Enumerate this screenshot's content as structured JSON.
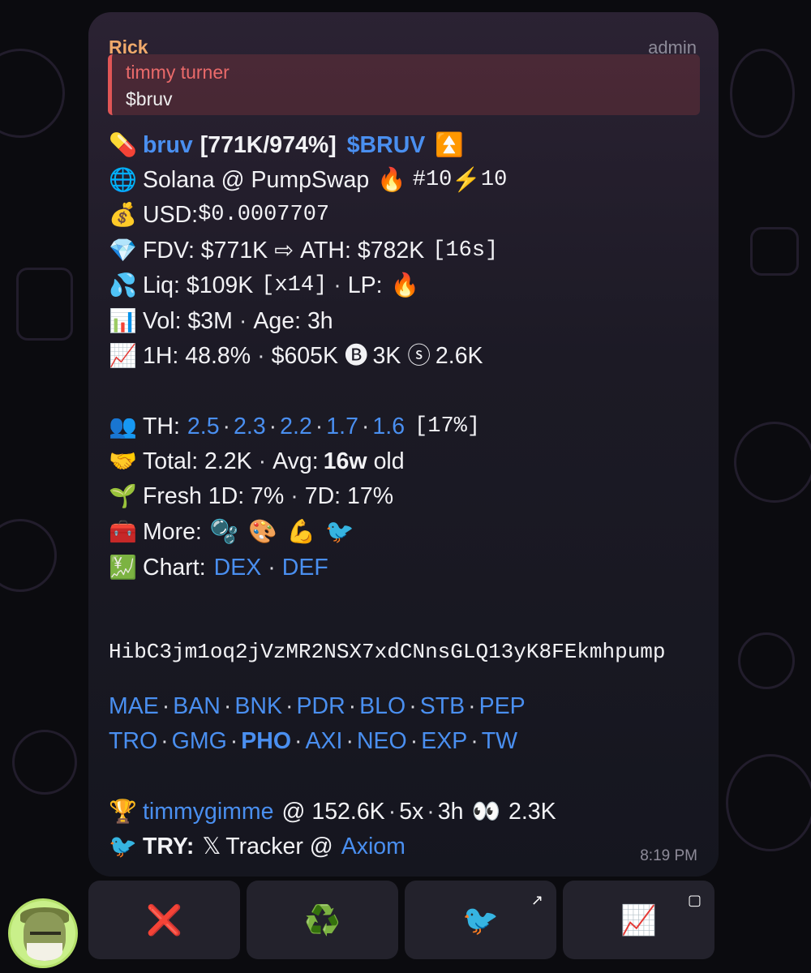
{
  "message": {
    "sender": "Rick",
    "role": "admin",
    "reply": {
      "name": "timmy turner",
      "text": "$bruv"
    },
    "time": "8:19 PM",
    "lines": {
      "title": {
        "icon": "💊",
        "name": "bruv",
        "stats": "[771K/974%]",
        "ticker": "$BRUV",
        "badge": "⏫"
      },
      "chain": {
        "icon": "🌐",
        "text": "Solana @ PumpSwap",
        "fire": "🔥",
        "rank": "#10",
        "bolt": "⚡",
        "boost": "10"
      },
      "usd": {
        "icon": "💰",
        "label": "USD: ",
        "value": "$0.0007707"
      },
      "fdv": {
        "icon": "💎",
        "label": "FDV: $771K",
        "arrow": "⇨",
        "ath": "ATH: $782K",
        "age": "[16s]"
      },
      "liq": {
        "icon": "💦",
        "label": "Liq: $109K",
        "mult": "[x14]",
        "sep": "·",
        "lp": "LP:",
        "lp_icon": "🔥"
      },
      "vol": {
        "icon": "📊",
        "vol": "Vol: $3M",
        "sep": "·",
        "age": "Age: 3h"
      },
      "h1": {
        "icon": "📈",
        "pct": "1H: 48.8%",
        "sep": "·",
        "vol": "$605K",
        "buy_icon": "🅑",
        "buys": "3K",
        "sell_icon": "ⓢ",
        "sells": "2.6K"
      },
      "th": {
        "icon": "👥",
        "label": "TH:",
        "values": [
          "2.5",
          "2.3",
          "2.2",
          "1.7",
          "1.6"
        ],
        "dot": "·",
        "pct": "[17%]"
      },
      "total": {
        "icon": "🤝",
        "label": "Total: 2.2K",
        "sep": "·",
        "avg": "Avg: ",
        "avg_value": "16w",
        "old": "old"
      },
      "fresh": {
        "icon": "🌱",
        "d1": "Fresh 1D: 7%",
        "sep": "·",
        "d7": "7D: 17%"
      },
      "more": {
        "icon": "🧰",
        "label": "More:",
        "items": [
          "🫧",
          "🎨",
          "💪",
          "🐦"
        ]
      },
      "chart": {
        "icon": "💹",
        "label": "Chart:",
        "dex": "DEX",
        "sep": "·",
        "def": "DEF"
      }
    },
    "contract": "HibC3jm1oq2jVzMR2NSX7xdCNnsGLQ13yK8FEkmhpump",
    "bot_links_row1": [
      "MAE",
      "BAN",
      "BNK",
      "PDR",
      "BLO",
      "STB",
      "PEP"
    ],
    "bot_links_row2": [
      "TRO",
      "GMG",
      "PHO",
      "AXI",
      "NEO",
      "EXP",
      "TW"
    ],
    "bot_link_dot": "·",
    "caller": {
      "icon": "🏆",
      "name": "timmygimme",
      "stats": "@ 152.6K",
      "dot": "·",
      "mult": "5x",
      "age": "3h",
      "eyes": "👀",
      "views": "2.3K"
    },
    "try": {
      "icon": "🐦",
      "label": "TRY:",
      "x": "𝕏",
      "text": "Tracker @",
      "link": "Axiom"
    }
  },
  "keyboard": {
    "buttons": [
      {
        "icon": "❌",
        "corner": ""
      },
      {
        "icon": "♻️",
        "corner": ""
      },
      {
        "icon": "🐦",
        "corner": "↗"
      },
      {
        "icon": "📈",
        "corner": "▢"
      }
    ]
  },
  "colors": {
    "link": "#4a8ff0",
    "sender": "#f0a96b",
    "reply_accent": "#e05656",
    "bubble": "#1c1a25"
  }
}
